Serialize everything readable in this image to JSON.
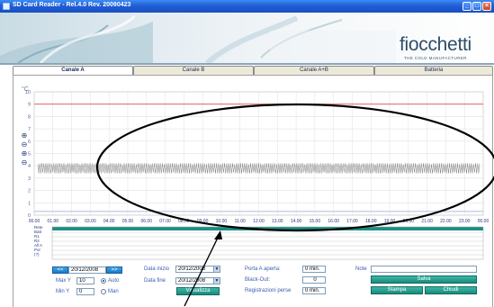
{
  "window": {
    "title": "SD Card Reader - Rel.4.0 Rev. 20090423"
  },
  "brand": {
    "name": "fiocchetti",
    "tagline": "THE COLD MANUFACTURER"
  },
  "tabs": [
    {
      "label": "Canale A",
      "active": true
    },
    {
      "label": "Canale B",
      "active": false
    },
    {
      "label": "Canale A+B",
      "active": false
    },
    {
      "label": "Batteria",
      "active": false
    }
  ],
  "chart": {
    "unit": "°C"
  },
  "legend_rows": [
    "Rete",
    "Batt",
    "R1",
    "R2",
    "All A",
    "Por",
    "(?)"
  ],
  "controls": {
    "prev": "<<",
    "next": ">>",
    "date": "20/12/2008",
    "max_y_label": "Max Y",
    "max_y_value": "10",
    "min_y_label": "Min Y",
    "min_y_value": "0",
    "auto_label": "Auto",
    "man_label": "Man",
    "date_start_label": "Data inizio",
    "date_start_value": "20/12/2008",
    "date_end_label": "Data fine",
    "date_end_value": "20/12/2008",
    "view_button": "Visualizza",
    "door_open_label": "Porta A aperta:",
    "door_open_value": "0 min.",
    "blackout_label": "Black-Out:",
    "blackout_value": "0",
    "reg_lost_label": "Registrazioni perse",
    "reg_lost_value": "0 min.",
    "note_label": "Note",
    "note_value": "",
    "save_button": "Salva",
    "print_button": "Stampa",
    "close_button": "Chiudi"
  },
  "chart_data": {
    "type": "line",
    "x": [
      "00.00",
      "01.00",
      "02.00",
      "03.00",
      "04.00",
      "05.00",
      "06.00",
      "07.00",
      "08.00",
      "09.00",
      "10.00",
      "11.00",
      "12.00",
      "13.00",
      "14.00",
      "15.00",
      "16.00",
      "17.00",
      "18.00",
      "19.00",
      "20.00",
      "21.00",
      "22.00",
      "23.00",
      "00.00"
    ],
    "y_ticks": [
      0,
      1,
      2,
      3,
      4,
      5,
      6,
      7,
      8,
      9,
      10
    ],
    "ylim": [
      0,
      10
    ],
    "series": [
      {
        "values_min": 3.4,
        "values_max": 4.2,
        "color": "#707070"
      }
    ],
    "limit_lines": [
      {
        "value": 9.0,
        "color": "#e04a4a"
      },
      {
        "value": 0.3,
        "color": "#9aa6d8"
      }
    ],
    "grid": true
  }
}
